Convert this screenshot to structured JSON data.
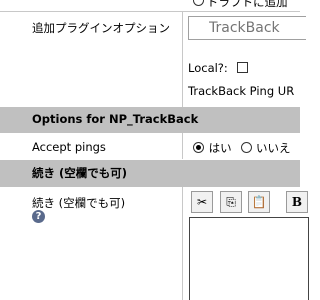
{
  "top_row": {
    "draft_option_label": "ドラフトに追加"
  },
  "plugin_options": {
    "label": "追加プラグインオプション",
    "trackback_placeholder": "TrackBack",
    "local_label": "Local?:",
    "ping_url_label": "TrackBack Ping UR"
  },
  "np_trackback": {
    "header": "Options for NP_TrackBack",
    "accept_pings_label": "Accept pings",
    "yes_label": "はい",
    "no_label": "いいえ"
  },
  "continuation": {
    "header": "続き (空欄でも可)",
    "label": "続き (空欄でも可)",
    "help_icon_glyph": "?",
    "toolbar": {
      "cut_glyph": "✂",
      "copy_glyph": "⎘",
      "paste_glyph": "📋",
      "bold_glyph": "B"
    }
  }
}
